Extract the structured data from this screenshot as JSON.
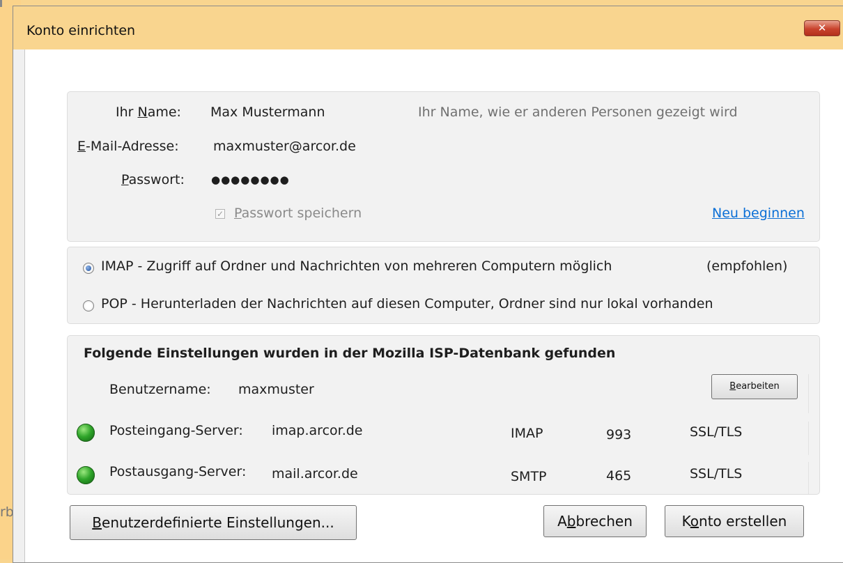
{
  "dialog": {
    "title": "Konto einrichten",
    "close_glyph": "✕"
  },
  "background": {
    "fragment": "rb"
  },
  "account": {
    "name_label": {
      "pre": "Ihr ",
      "key": "N",
      "post": "ame:"
    },
    "name_value": "Max Mustermann",
    "name_hint": "Ihr Name, wie er anderen Personen gezeigt wird",
    "email_label": {
      "key": "E",
      "post": "-Mail-Adresse:"
    },
    "email_value": "maxmuster@arcor.de",
    "password_label": {
      "key": "P",
      "post": "asswort:"
    },
    "password_value": "●●●●●●●●",
    "save_password": {
      "key": "P",
      "post": "asswort speichern",
      "checked": true,
      "check_glyph": "✓"
    },
    "restart_link": "Neu beginnen"
  },
  "protocol": {
    "imap": {
      "label": "IMAP - Zugriff auf Ordner und Nachrichten von mehreren Computern möglich",
      "note": "(empfohlen)",
      "selected": true
    },
    "pop": {
      "label": "POP - Herunterladen der Nachrichten auf diesen Computer, Ordner sind nur lokal vorhanden",
      "selected": false
    }
  },
  "isp": {
    "heading": "Folgende Einstellungen wurden in der Mozilla ISP-Datenbank gefunden",
    "username_label": "Benutzername:",
    "username_value": "maxmuster",
    "edit_button": {
      "key": "B",
      "post": "earbeiten"
    },
    "incoming": {
      "label": "Posteingang-Server:",
      "host": "imap.arcor.de",
      "protocol": "IMAP",
      "port": "993",
      "security": "SSL/TLS",
      "status": "ok"
    },
    "outgoing": {
      "label": "Postausgang-Server:",
      "host": "mail.arcor.de",
      "protocol": "SMTP",
      "port": "465",
      "security": "SSL/TLS",
      "status": "ok"
    }
  },
  "footer": {
    "advanced_button": {
      "key": "B",
      "post": "enutzerdefinierte Einstellungen..."
    },
    "cancel_button": {
      "pre": "A",
      "key": "b",
      "post": "brechen"
    },
    "create_button": {
      "pre": "K",
      "key": "o",
      "post": "nto erstellen"
    }
  },
  "colors": {
    "title_bar": "#f9d58f",
    "link": "#0b6fd6",
    "status_ok": "#2fa52a",
    "close_button": "#c9432d"
  }
}
